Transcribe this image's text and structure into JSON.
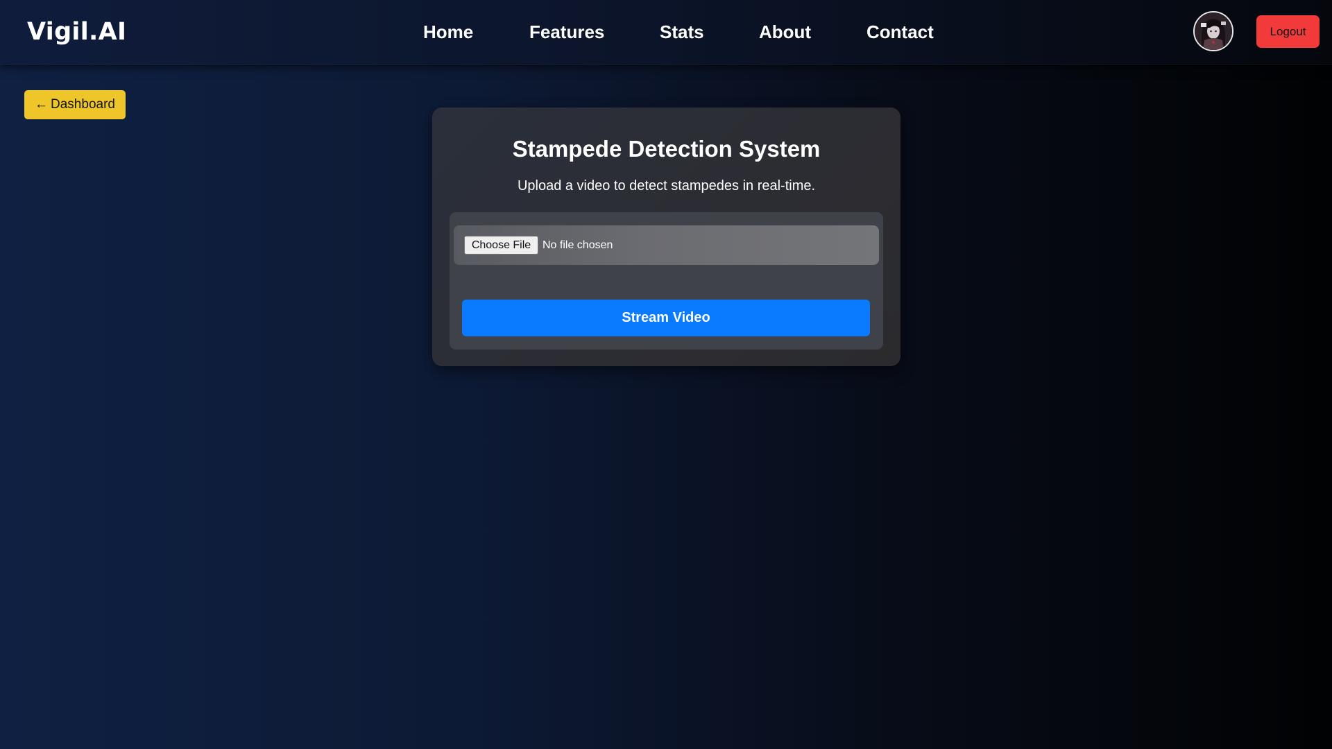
{
  "header": {
    "brand": "Vigil.AI",
    "nav": [
      {
        "label": "Home"
      },
      {
        "label": "Features"
      },
      {
        "label": "Stats"
      },
      {
        "label": "About"
      },
      {
        "label": "Contact"
      }
    ],
    "avatar_icon": "user-avatar-icon",
    "logout_label": "Logout"
  },
  "back": {
    "arrow": "←",
    "label": "Dashboard"
  },
  "card": {
    "title": "Stampede Detection System",
    "subtitle": "Upload a video to detect stampedes in real-time.",
    "file_input": {
      "button_label": "Choose File",
      "status": "No file chosen"
    },
    "stream_label": "Stream Video"
  },
  "colors": {
    "logout": "#f23a3a",
    "back_button": "#eec62a",
    "stream_button": "#0a7bff"
  }
}
